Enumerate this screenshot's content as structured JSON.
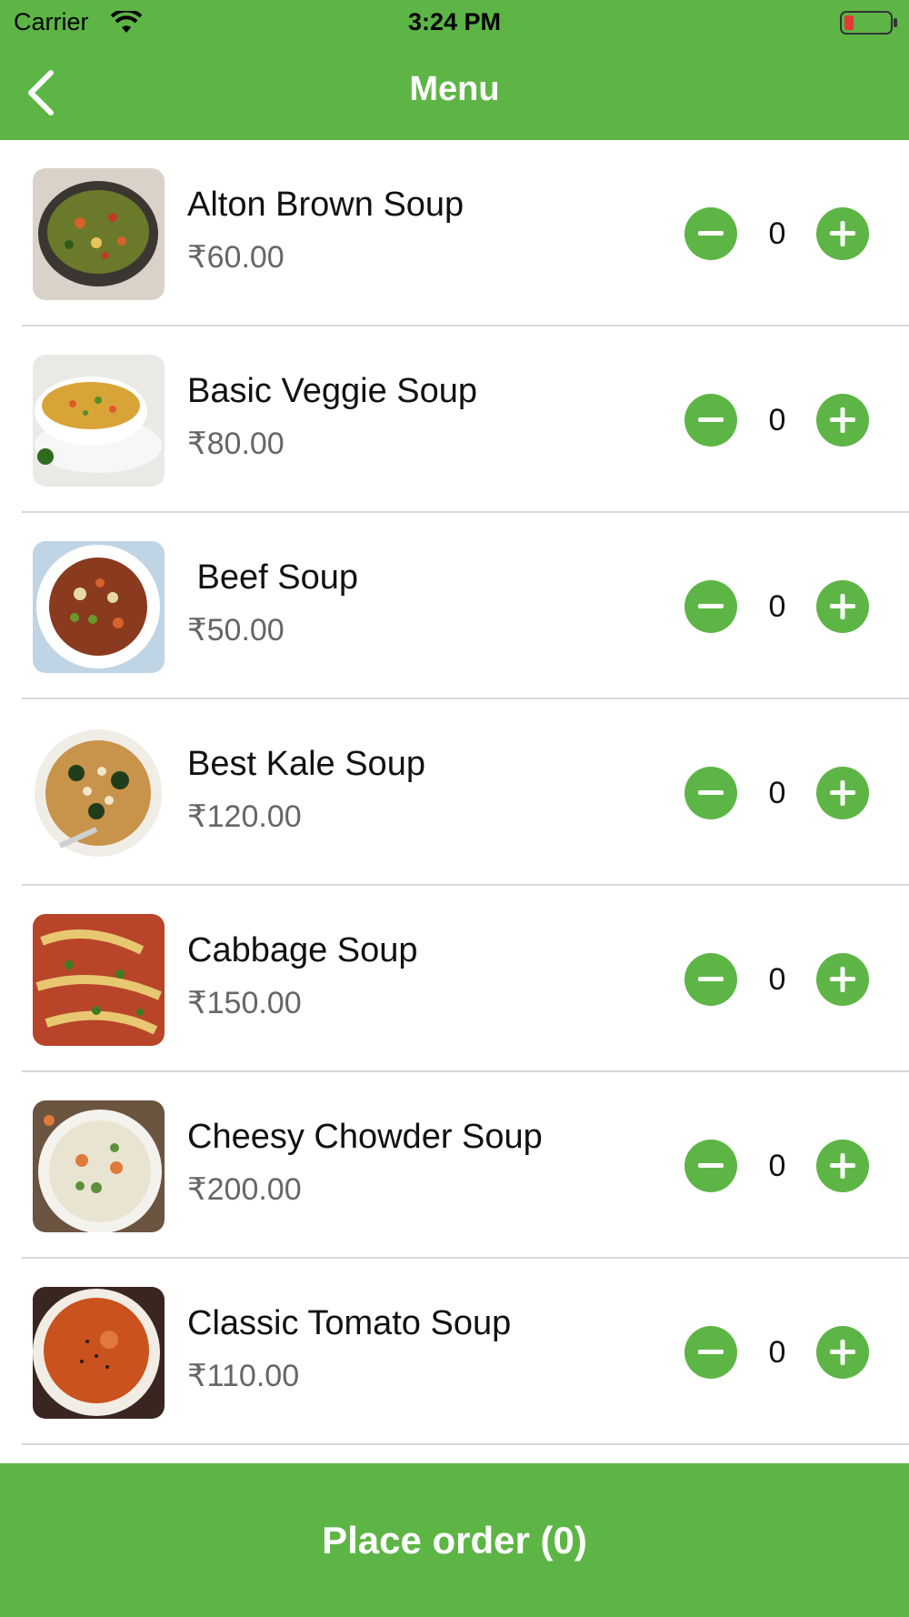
{
  "status_bar": {
    "carrier": "Carrier",
    "time": "3:24 PM"
  },
  "nav": {
    "title": "Menu"
  },
  "items": [
    {
      "name": "Alton Brown Soup",
      "price": "₹60.00",
      "qty": "0"
    },
    {
      "name": "Basic Veggie Soup",
      "price": "₹80.00",
      "qty": "0"
    },
    {
      "name": " Beef Soup",
      "price": "₹50.00",
      "qty": "0"
    },
    {
      "name": "Best Kale Soup",
      "price": "₹120.00",
      "qty": "0"
    },
    {
      "name": "Cabbage Soup",
      "price": "₹150.00",
      "qty": "0"
    },
    {
      "name": "Cheesy Chowder Soup",
      "price": "₹200.00",
      "qty": "0"
    },
    {
      "name": "Classic Tomato Soup",
      "price": "₹110.00",
      "qty": "0"
    }
  ],
  "footer": {
    "place_order_label": "Place order (0)"
  },
  "colors": {
    "accent": "#5db545",
    "separator": "#d7d7d7",
    "price_text": "#666666"
  }
}
